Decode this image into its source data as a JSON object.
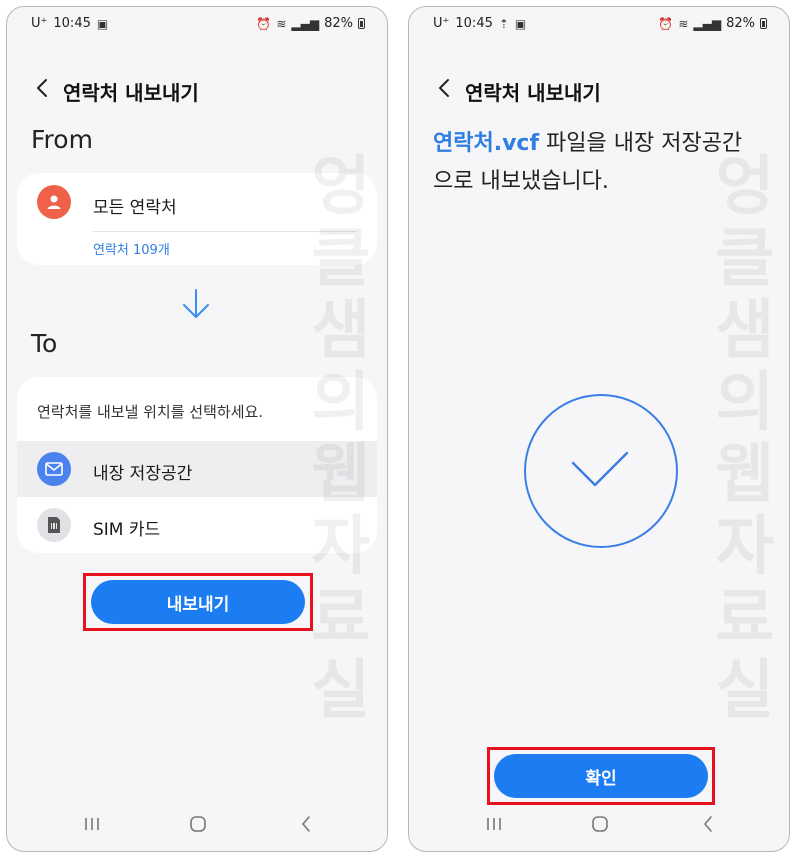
{
  "status_bar": {
    "carrier": "U⁺",
    "time": "10:45",
    "battery": "82%"
  },
  "left_screen": {
    "title": "연락처 내보내기",
    "from_label": "From",
    "source": {
      "label": "모든 연락처",
      "count": "연락처 109개"
    },
    "to_label": "To",
    "instruction": "연락처를 내보낼 위치를 선택하세요.",
    "options": [
      {
        "label": "내장 저장공간",
        "icon": "mail-icon",
        "selected": true
      },
      {
        "label": "SIM 카드",
        "icon": "sim-card-icon",
        "selected": false
      }
    ],
    "export_button": "내보내기",
    "watermark": "엉클샘의웹자료실"
  },
  "right_screen": {
    "title": "연락처 내보내기",
    "message_filename": "연락처.vcf",
    "message_rest": " 파일을 내장 저장공간으로 내보냈습니다.",
    "confirm_button": "확인",
    "watermark": "엉클샘의웹자료실"
  },
  "colors": {
    "accent": "#1c7df2",
    "link": "#2f7ee0",
    "highlight": "#e8121c",
    "avatar": "#f0614a"
  }
}
